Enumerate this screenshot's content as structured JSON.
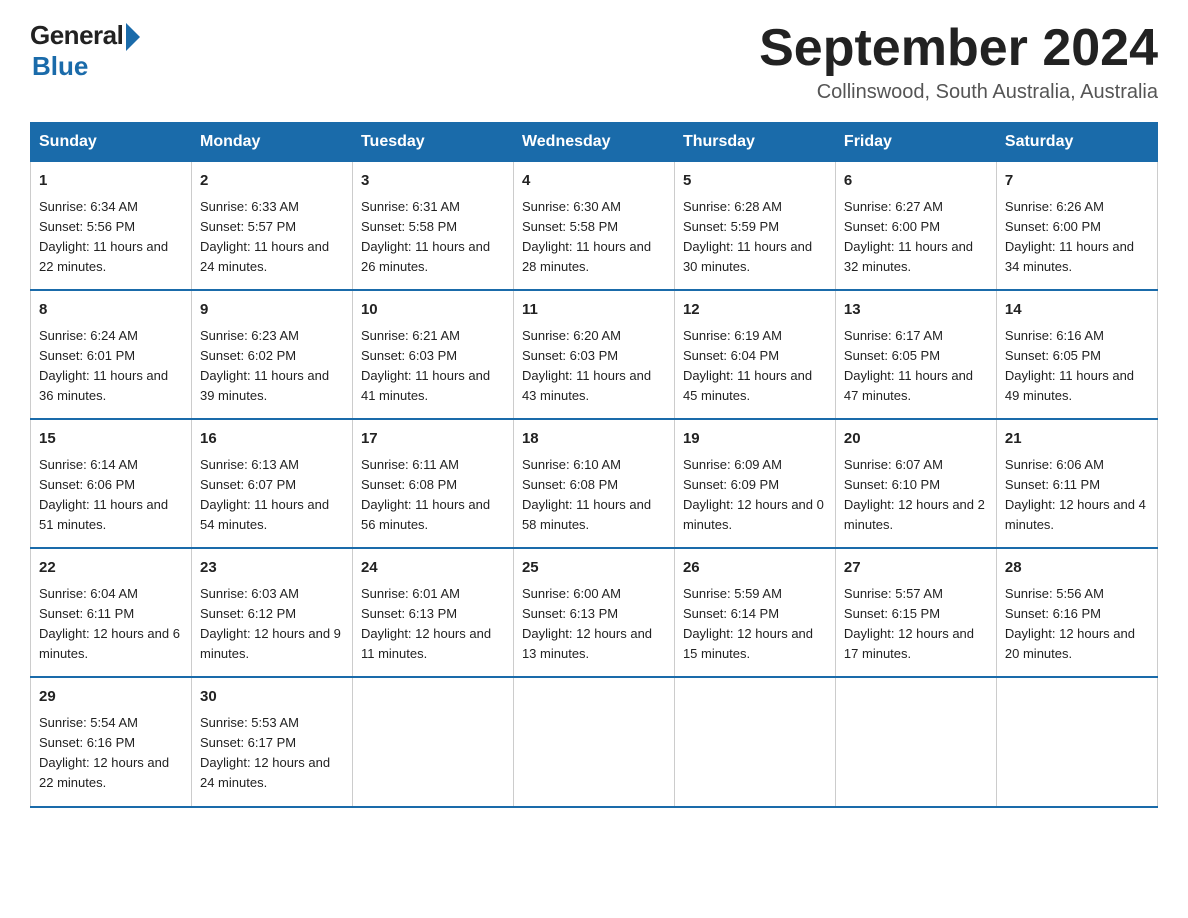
{
  "logo": {
    "general": "General",
    "blue": "Blue"
  },
  "title": "September 2024",
  "location": "Collinswood, South Australia, Australia",
  "days_of_week": [
    "Sunday",
    "Monday",
    "Tuesday",
    "Wednesday",
    "Thursday",
    "Friday",
    "Saturday"
  ],
  "weeks": [
    [
      {
        "day": "1",
        "sunrise": "6:34 AM",
        "sunset": "5:56 PM",
        "daylight": "11 hours and 22 minutes."
      },
      {
        "day": "2",
        "sunrise": "6:33 AM",
        "sunset": "5:57 PM",
        "daylight": "11 hours and 24 minutes."
      },
      {
        "day": "3",
        "sunrise": "6:31 AM",
        "sunset": "5:58 PM",
        "daylight": "11 hours and 26 minutes."
      },
      {
        "day": "4",
        "sunrise": "6:30 AM",
        "sunset": "5:58 PM",
        "daylight": "11 hours and 28 minutes."
      },
      {
        "day": "5",
        "sunrise": "6:28 AM",
        "sunset": "5:59 PM",
        "daylight": "11 hours and 30 minutes."
      },
      {
        "day": "6",
        "sunrise": "6:27 AM",
        "sunset": "6:00 PM",
        "daylight": "11 hours and 32 minutes."
      },
      {
        "day": "7",
        "sunrise": "6:26 AM",
        "sunset": "6:00 PM",
        "daylight": "11 hours and 34 minutes."
      }
    ],
    [
      {
        "day": "8",
        "sunrise": "6:24 AM",
        "sunset": "6:01 PM",
        "daylight": "11 hours and 36 minutes."
      },
      {
        "day": "9",
        "sunrise": "6:23 AM",
        "sunset": "6:02 PM",
        "daylight": "11 hours and 39 minutes."
      },
      {
        "day": "10",
        "sunrise": "6:21 AM",
        "sunset": "6:03 PM",
        "daylight": "11 hours and 41 minutes."
      },
      {
        "day": "11",
        "sunrise": "6:20 AM",
        "sunset": "6:03 PM",
        "daylight": "11 hours and 43 minutes."
      },
      {
        "day": "12",
        "sunrise": "6:19 AM",
        "sunset": "6:04 PM",
        "daylight": "11 hours and 45 minutes."
      },
      {
        "day": "13",
        "sunrise": "6:17 AM",
        "sunset": "6:05 PM",
        "daylight": "11 hours and 47 minutes."
      },
      {
        "day": "14",
        "sunrise": "6:16 AM",
        "sunset": "6:05 PM",
        "daylight": "11 hours and 49 minutes."
      }
    ],
    [
      {
        "day": "15",
        "sunrise": "6:14 AM",
        "sunset": "6:06 PM",
        "daylight": "11 hours and 51 minutes."
      },
      {
        "day": "16",
        "sunrise": "6:13 AM",
        "sunset": "6:07 PM",
        "daylight": "11 hours and 54 minutes."
      },
      {
        "day": "17",
        "sunrise": "6:11 AM",
        "sunset": "6:08 PM",
        "daylight": "11 hours and 56 minutes."
      },
      {
        "day": "18",
        "sunrise": "6:10 AM",
        "sunset": "6:08 PM",
        "daylight": "11 hours and 58 minutes."
      },
      {
        "day": "19",
        "sunrise": "6:09 AM",
        "sunset": "6:09 PM",
        "daylight": "12 hours and 0 minutes."
      },
      {
        "day": "20",
        "sunrise": "6:07 AM",
        "sunset": "6:10 PM",
        "daylight": "12 hours and 2 minutes."
      },
      {
        "day": "21",
        "sunrise": "6:06 AM",
        "sunset": "6:11 PM",
        "daylight": "12 hours and 4 minutes."
      }
    ],
    [
      {
        "day": "22",
        "sunrise": "6:04 AM",
        "sunset": "6:11 PM",
        "daylight": "12 hours and 6 minutes."
      },
      {
        "day": "23",
        "sunrise": "6:03 AM",
        "sunset": "6:12 PM",
        "daylight": "12 hours and 9 minutes."
      },
      {
        "day": "24",
        "sunrise": "6:01 AM",
        "sunset": "6:13 PM",
        "daylight": "12 hours and 11 minutes."
      },
      {
        "day": "25",
        "sunrise": "6:00 AM",
        "sunset": "6:13 PM",
        "daylight": "12 hours and 13 minutes."
      },
      {
        "day": "26",
        "sunrise": "5:59 AM",
        "sunset": "6:14 PM",
        "daylight": "12 hours and 15 minutes."
      },
      {
        "day": "27",
        "sunrise": "5:57 AM",
        "sunset": "6:15 PM",
        "daylight": "12 hours and 17 minutes."
      },
      {
        "day": "28",
        "sunrise": "5:56 AM",
        "sunset": "6:16 PM",
        "daylight": "12 hours and 20 minutes."
      }
    ],
    [
      {
        "day": "29",
        "sunrise": "5:54 AM",
        "sunset": "6:16 PM",
        "daylight": "12 hours and 22 minutes."
      },
      {
        "day": "30",
        "sunrise": "5:53 AM",
        "sunset": "6:17 PM",
        "daylight": "12 hours and 24 minutes."
      },
      null,
      null,
      null,
      null,
      null
    ]
  ],
  "labels": {
    "sunrise": "Sunrise: ",
    "sunset": "Sunset: ",
    "daylight": "Daylight: "
  }
}
